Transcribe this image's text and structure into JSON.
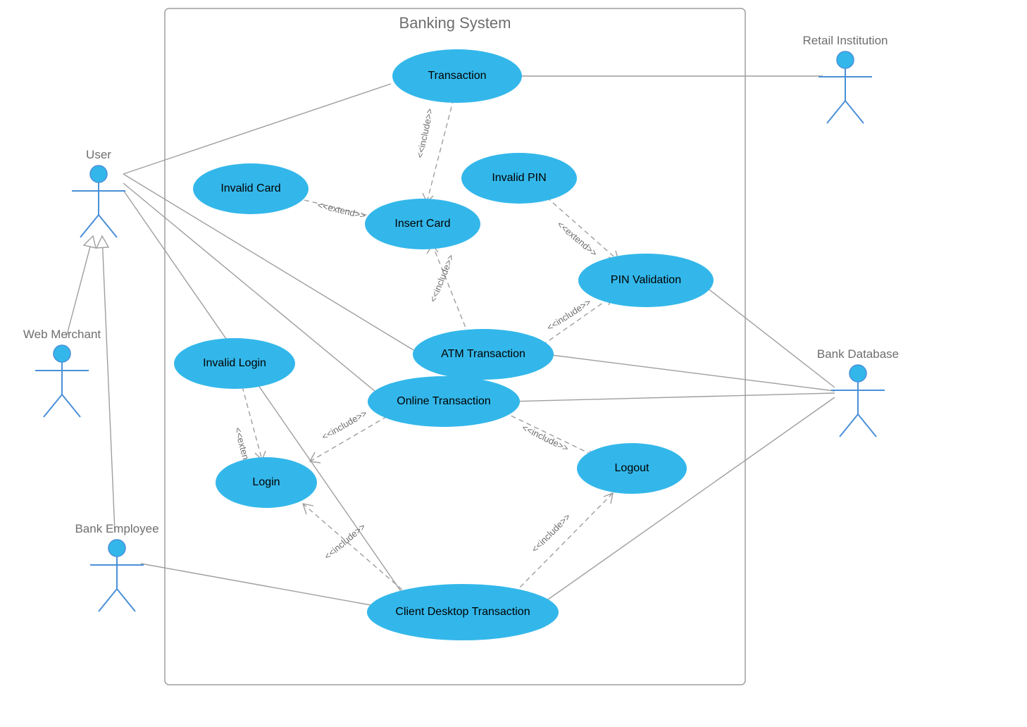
{
  "system": {
    "title": "Banking System"
  },
  "actors": {
    "user": "User",
    "web_merchant": "Web Merchant",
    "bank_employee": "Bank Employee",
    "retail_institution": "Retail Institution",
    "bank_database": "Bank Database"
  },
  "usecases": {
    "transaction": "Transaction",
    "invalid_card": "Invalid Card",
    "insert_card": "Insert Card",
    "invalid_pin": "Invalid PIN",
    "pin_validation": "PIN Validation",
    "atm_tx": "ATM Transaction",
    "invalid_login": "Invalid Login",
    "online_tx": "Online Transaction",
    "login": "Login",
    "logout": "Logout",
    "client_tx": "Client Desktop Transaction"
  },
  "relations": {
    "include": "<<include>>",
    "extend": "<<extend>>"
  }
}
